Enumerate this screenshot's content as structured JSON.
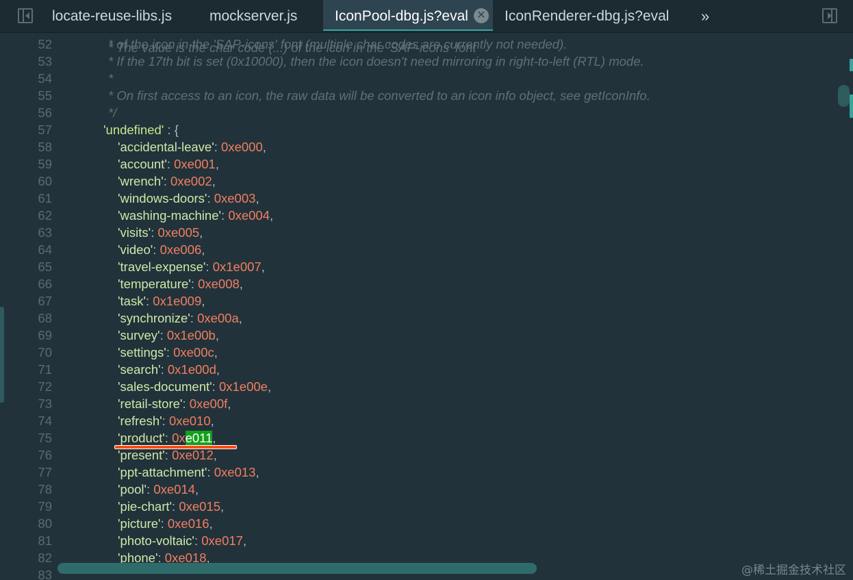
{
  "tabs": [
    {
      "label": "locate-reuse-libs.js",
      "active": false
    },
    {
      "label": "mockserver.js",
      "active": false
    },
    {
      "label": "IconPool-dbg.js?eval",
      "active": true
    },
    {
      "label": "IconRenderer-dbg.js?eval",
      "active": false
    }
  ],
  "tab_close_glyph": "✕",
  "overflow_glyph": "»",
  "icons": [
    "toggle-navigator-icon",
    "close-icon",
    "more-tabs-icon",
    "toggle-debugger-icon"
  ],
  "colors": {
    "background": "#22323a",
    "comment": "#5d7078",
    "string": "#c3e88d",
    "number": "#f07f62",
    "highlight": "#12a11c",
    "annotation_underline": "#ff4a12"
  },
  "header": {
    "partial_line": "* The value is the char code (...) of the icon in the 'SAP-icons' font"
  },
  "comment_lines": [
    {
      "num": "52",
      "text": "* of the icon in the 'SAP-icons' font (multiple char codes are currently not needed)."
    },
    {
      "num": "53",
      "text": "* If the 17th bit is set (0x10000), then the icon doesn't need mirroring in right-to-left (RTL) mode."
    },
    {
      "num": "54",
      "text": "*"
    },
    {
      "num": "55",
      "text": "* On first access to an icon, the raw data will be converted to an icon info object, see getIconInfo."
    },
    {
      "num": "56",
      "text": "*/"
    }
  ],
  "object_open": {
    "num": "57",
    "key": "'undefined'",
    "rest": " : {"
  },
  "entries": [
    {
      "num": "58",
      "key": "'accidental-leave'",
      "value": "0xe000"
    },
    {
      "num": "59",
      "key": "'account'",
      "value": "0xe001"
    },
    {
      "num": "60",
      "key": "'wrench'",
      "value": "0xe002"
    },
    {
      "num": "61",
      "key": "'windows-doors'",
      "value": "0xe003"
    },
    {
      "num": "62",
      "key": "'washing-machine'",
      "value": "0xe004"
    },
    {
      "num": "63",
      "key": "'visits'",
      "value": "0xe005"
    },
    {
      "num": "64",
      "key": "'video'",
      "value": "0xe006"
    },
    {
      "num": "65",
      "key": "'travel-expense'",
      "value": "0x1e007"
    },
    {
      "num": "66",
      "key": "'temperature'",
      "value": "0xe008"
    },
    {
      "num": "67",
      "key": "'task'",
      "value": "0x1e009"
    },
    {
      "num": "68",
      "key": "'synchronize'",
      "value": "0xe00a"
    },
    {
      "num": "69",
      "key": "'survey'",
      "value": "0x1e00b"
    },
    {
      "num": "70",
      "key": "'settings'",
      "value": "0xe00c"
    },
    {
      "num": "71",
      "key": "'search'",
      "value": "0x1e00d"
    },
    {
      "num": "72",
      "key": "'sales-document'",
      "value": "0x1e00e"
    },
    {
      "num": "73",
      "key": "'retail-store'",
      "value": "0xe00f"
    },
    {
      "num": "74",
      "key": "'refresh'",
      "value": "0xe010"
    },
    {
      "num": "75",
      "key": "'product'",
      "value": "0xe011",
      "value_prefix": "0x",
      "value_highlight": "e011"
    },
    {
      "num": "76",
      "key": "'present'",
      "value": "0xe012"
    },
    {
      "num": "77",
      "key": "'ppt-attachment'",
      "value": "0xe013"
    },
    {
      "num": "78",
      "key": "'pool'",
      "value": "0xe014"
    },
    {
      "num": "79",
      "key": "'pie-chart'",
      "value": "0xe015"
    },
    {
      "num": "80",
      "key": "'picture'",
      "value": "0xe016"
    },
    {
      "num": "81",
      "key": "'photo-voltaic'",
      "value": "0xe017"
    },
    {
      "num": "82",
      "key": "'phone'",
      "value": "0xe018"
    },
    {
      "num": "83",
      "key": "",
      "value": ""
    }
  ],
  "watermark": "@稀土掘金技术社区"
}
